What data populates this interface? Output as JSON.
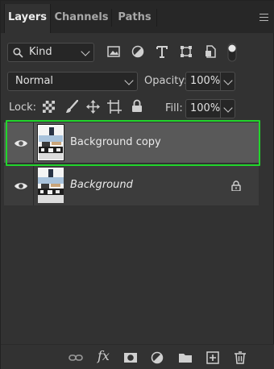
{
  "tabs": [
    {
      "label": "Layers",
      "active": true
    },
    {
      "label": "Channels",
      "active": false
    },
    {
      "label": "Paths",
      "active": false
    }
  ],
  "filter": {
    "kind_label": "Kind"
  },
  "blend": {
    "mode": "Normal"
  },
  "opacity": {
    "label": "Opacity:",
    "value": "100%"
  },
  "lock": {
    "label": "Lock:"
  },
  "fill": {
    "label": "Fill:",
    "value": "100%"
  },
  "layers": [
    {
      "name": "Background copy",
      "selected": true,
      "visible": true,
      "locked": false
    },
    {
      "name": "Background",
      "selected": false,
      "visible": true,
      "locked": true
    }
  ],
  "bottom": {
    "fx_label": "fx"
  },
  "colors": {
    "panel": "#323232",
    "selection_outline": "#22d52c",
    "selected_row": "#595959"
  }
}
